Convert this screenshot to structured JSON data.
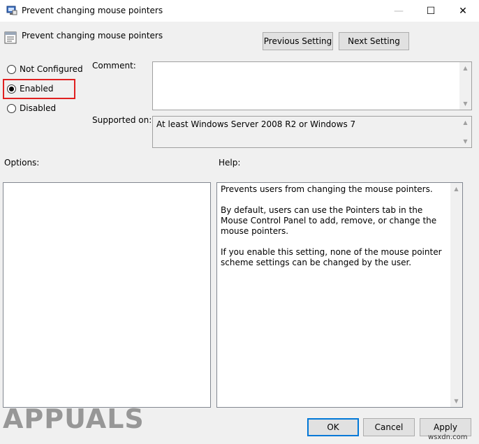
{
  "window": {
    "title": "Prevent changing mouse pointers",
    "controls": {
      "minimize": "—",
      "maximize": "☐",
      "close": "✕"
    }
  },
  "header": {
    "policy_name": "Prevent changing mouse pointers",
    "previous_label": "Previous Setting",
    "next_label": "Next Setting"
  },
  "state": {
    "options": [
      {
        "label": "Not Configured",
        "checked": false
      },
      {
        "label": "Enabled",
        "checked": true
      },
      {
        "label": "Disabled",
        "checked": false
      }
    ]
  },
  "comment": {
    "label": "Comment:",
    "value": ""
  },
  "supported": {
    "label": "Supported on:",
    "value": "At least Windows Server 2008 R2 or Windows 7"
  },
  "options_panel": {
    "label": "Options:"
  },
  "help_panel": {
    "label": "Help:",
    "paragraphs": [
      "Prevents users from changing the mouse pointers.",
      "By default, users can use the Pointers tab in the Mouse Control Panel to add, remove, or change the mouse pointers.",
      "If you enable this setting, none of the mouse pointer scheme settings can be changed by the user."
    ]
  },
  "footer": {
    "ok_label": "OK",
    "cancel_label": "Cancel",
    "apply_label": "Apply"
  },
  "watermark": {
    "logo": "APPUALS",
    "site": "wsxdn.com"
  },
  "colors": {
    "highlight": "#e02020",
    "accent": "#0078d7"
  }
}
